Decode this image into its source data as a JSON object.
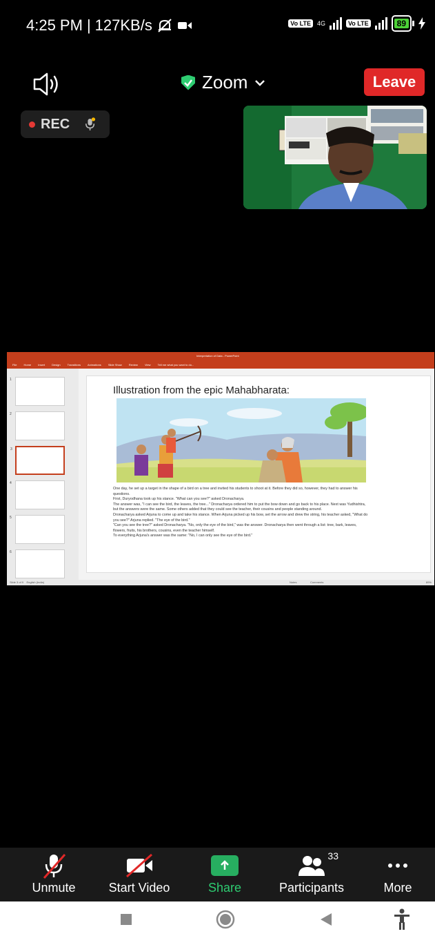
{
  "status_bar": {
    "time": "4:25 PM",
    "separator": "|",
    "network_speed": "127KB/s",
    "volte_label_1": "Vo LTE",
    "network_type": "4G",
    "volte_label_2": "Vo LTE",
    "battery_level": "89",
    "icons": [
      "bell-off-icon",
      "video-camera-icon",
      "signal-icon",
      "battery-icon",
      "charging-icon"
    ]
  },
  "header": {
    "meeting_title": "Zoom",
    "leave_label": "Leave",
    "leave_color": "#e02828",
    "secure_color": "#2ecc71"
  },
  "recording": {
    "label": "REC"
  },
  "shared_screen": {
    "window_title": "Interpretation of Data - PowerPoint",
    "ribbon_tabs": [
      "File",
      "Home",
      "Insert",
      "Design",
      "Transitions",
      "Animations",
      "Slide Show",
      "Review",
      "View"
    ],
    "tell_me": "Tell me what you want to do...",
    "thumb_numbers": [
      "1",
      "2",
      "3",
      "4",
      "5",
      "6"
    ],
    "active_slide": 3,
    "slide_title": "Illustration from the epic Mahabharata:",
    "slide_paragraphs": [
      "One day, he set up a target in the shape of a bird on a tree and invited his students to shoot at it. Before they did so, however, they had to answer his questions.",
      "First, Duryodhana took up his stance. \"What can you see?\" asked Dronacharya.",
      "The answer was, \"I can see the bird, the leaves, the tree...\" Dronacharya ordered him to put the bow down and go back to his place. Next was Yudhishtra, but the answers were the same. Some others added that they could see the teacher, their cousins and people standing around.",
      "Dronacharya asked Arjuna to come up and take his stance. When Arjuna picked up his bow, set the arrow and drew the string, his teacher asked, \"What do you see?\" Arjuna replied. \"The eye of the bird.\"",
      "\"Can you see the tree?\" asked Dronacharya. \"No, only the eye of the bird,\" was the answer. Dronacharya then went through a list: tree, bark, leaves, flowers, fruits, his brothers, cousins, even the teacher himself.",
      "To everything Arjuna's answer was the same: \"No, I can only see the eye of the bird.\""
    ],
    "status_left": "Slide 3 of 9",
    "status_lang": "English (India)",
    "status_notes": "Notes",
    "status_comments": "Comments",
    "status_zoom": "89%"
  },
  "toolbar": {
    "unmute_label": "Unmute",
    "video_label": "Start Video",
    "share_label": "Share",
    "participants_label": "Participants",
    "participants_count": "33",
    "more_label": "More",
    "share_color": "#27ae60"
  },
  "nav_bar": {
    "icons": [
      "recent-apps-icon",
      "home-icon",
      "back-icon",
      "accessibility-icon"
    ]
  }
}
